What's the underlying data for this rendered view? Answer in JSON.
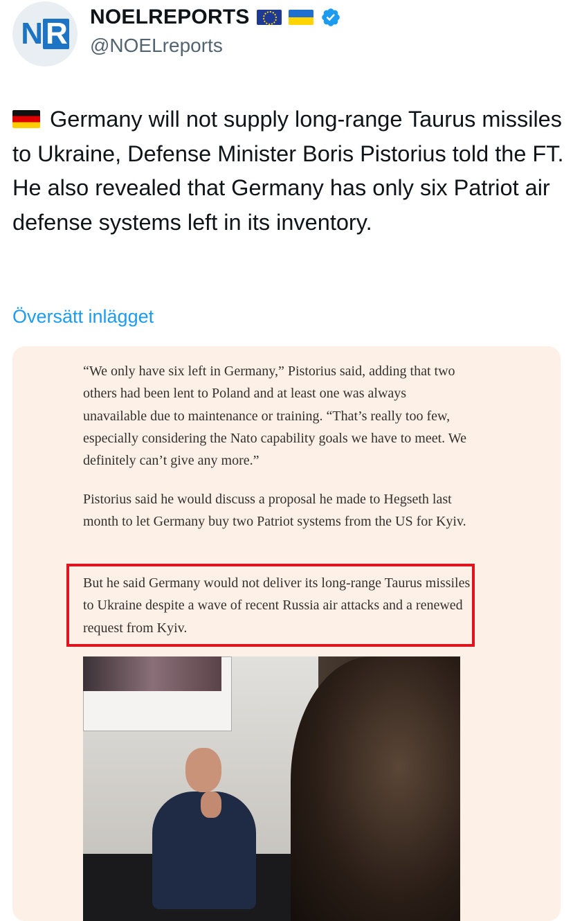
{
  "header": {
    "avatar_text_n": "N",
    "avatar_text_r": "R",
    "display_name": "NOELREPORTS",
    "handle": "@NOELreports",
    "flags": [
      "eu-flag-icon",
      "ukraine-flag-icon"
    ],
    "verified_icon": "verified-badge-icon"
  },
  "tweet": {
    "flag_icon": "germany-flag-icon",
    "text": "Germany will not supply long-range Taurus missiles to Ukraine, Defense Minister Boris Pistorius told the FT. He also revealed that Germany has only six Patriot air defense systems left in its inventory.",
    "translate_label": "Översätt inlägget"
  },
  "media": {
    "paragraph_1": "“We only have six left in Germany,” Pistorius said, adding that two others had been lent to Poland and at least one was always unavailable due to maintenance or training. “That’s really too few, especially considering the Nato capability goals we have to meet. We definitely can’t give any more.”",
    "paragraph_2": "Pistorius said he would discuss a proposal he made to Hegseth last month to let Germany buy two Patriot systems from the US for Kyiv.",
    "paragraph_3": "But he said Germany would not deliver its long-range Taurus missiles to Ukraine despite a wave of recent Russia air attacks and a renewed request from Kyiv.",
    "highlight_color": "#e0141e",
    "card_background": "#fdf0e6"
  },
  "colors": {
    "link": "#1d9bf0",
    "handle": "#536471",
    "text": "#0f1419",
    "verified": "#1d9bf0"
  }
}
